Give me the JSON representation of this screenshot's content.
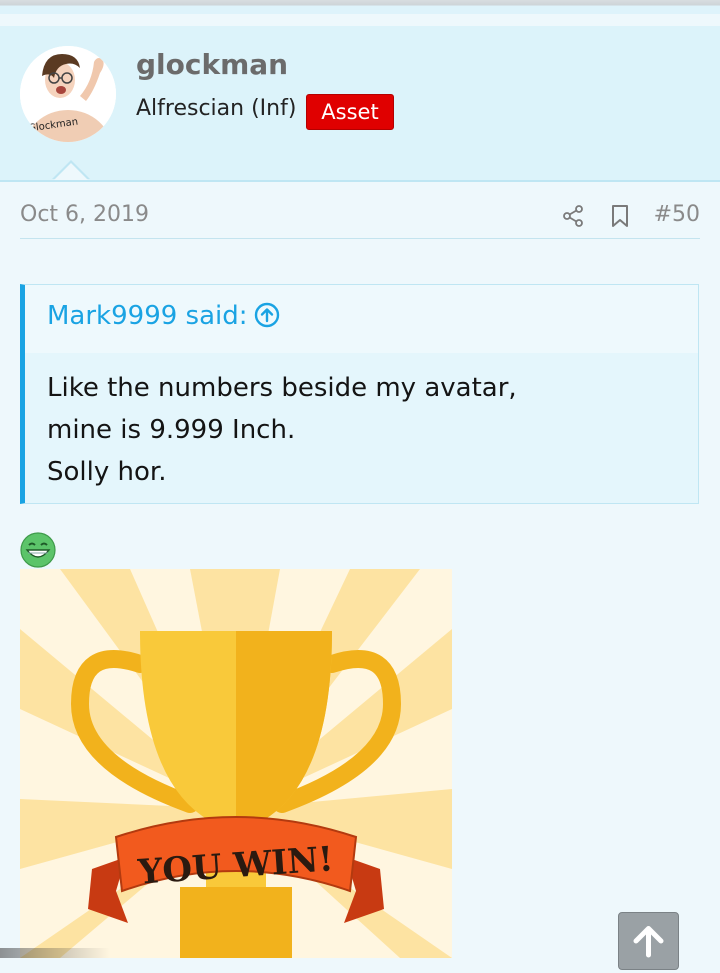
{
  "post": {
    "username": "glockman",
    "user_title": "Alfrescian (Inf)",
    "badge": "Asset",
    "avatar_caption": "Glockman",
    "date": "Oct 6, 2019",
    "number": "#50"
  },
  "quote": {
    "author": "Mark9999 said:",
    "lines": [
      "Like the numbers beside my avatar,",
      "mine is 9.999 Inch.",
      "Solly hor."
    ]
  },
  "image": {
    "banner_text": "YOU WIN!"
  },
  "icons": {
    "share": "share-icon",
    "bookmark": "bookmark-icon",
    "quote_up": "arrow-up-circle-icon",
    "smiley": "grin-smiley-icon",
    "scroll_top": "arrow-up-icon"
  },
  "colors": {
    "accent": "#1aa3e3",
    "badge": "#e00000",
    "header_bg": "#dcf3fa",
    "page_bg": "#eef8fc"
  }
}
